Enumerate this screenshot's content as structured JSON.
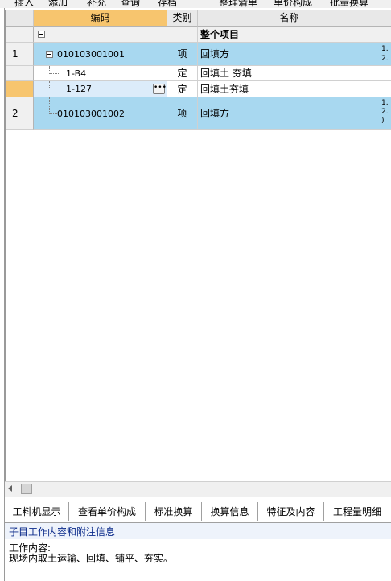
{
  "toolbar": {
    "items": [
      "插入",
      "添加",
      "补充",
      "查询",
      "存档",
      "整理清单",
      "单价构成",
      "批量换算"
    ]
  },
  "grid": {
    "columns": [
      "编码",
      "类别",
      "名称"
    ],
    "group_row": {
      "label": "整个项目"
    },
    "rows": [
      {
        "num": "1",
        "code": "010103001001",
        "type": "项",
        "name": "回填方",
        "extra_lines": [
          "1.",
          "2."
        ]
      },
      {
        "num": "",
        "code": "1-B4",
        "type": "定",
        "name": "回填土 夯填"
      },
      {
        "num": "",
        "code": "1-127",
        "type": "定",
        "name": "回填土夯填"
      },
      {
        "num": "2",
        "code": "010103001002",
        "type": "项",
        "name": "回填方",
        "extra_lines": [
          "1.",
          "2.",
          ")"
        ]
      }
    ]
  },
  "bottom_tabs": [
    "工料机显示",
    "查看单价构成",
    "标准换算",
    "换算信息",
    "特征及内容",
    "工程量明细"
  ],
  "info_panel": {
    "title": "子目工作内容和附注信息",
    "line1": "工作内容:",
    "line2": "现场内取土运输、回填、铺平、夯实。"
  },
  "colors": {
    "header_active": "#f7c56e",
    "row_highlight": "#a8d8f0",
    "row_selected": "#dcecfa"
  },
  "icons": {
    "expand": "minus-box-icon",
    "more": "ellipsis-button-icon"
  }
}
